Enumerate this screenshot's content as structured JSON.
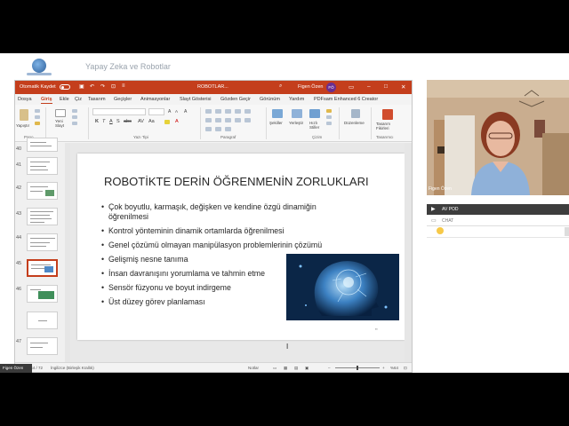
{
  "meeting": {
    "title": "Yapay Zeka ve Robotlar"
  },
  "ppt": {
    "autosave_label": "Otomatik Kaydet",
    "doc_title": "ROBOTLAR...",
    "user_name": "Figen Özen",
    "user_initials": "FÖ",
    "tabs": [
      "Dosya",
      "Giriş",
      "Ekle",
      "Çiz",
      "Tasarım",
      "Geçişler",
      "Animasyonlar",
      "Slayt Gösterisi",
      "Gözden Geçir",
      "Görünüm",
      "Yardım",
      "PDFsam Enhanced 6 Creator"
    ],
    "active_tab": "Giriş",
    "ribbon": {
      "paste": "Yapıştır",
      "new_slide": "Yeni\nSlayt",
      "shapes": "Şekiller",
      "arrange": "Yerleştir",
      "quick_styles": "Hızlı\nStiller",
      "edit": "Düzenleme",
      "designer": "Tasarım\nFikirleri",
      "groups": {
        "clipboard": "Pano",
        "font": "Yazı Tipi",
        "paragraph": "Paragraf",
        "drawing": "Çizim",
        "designer": "Tasarımcı"
      }
    },
    "thumb_numbers": [
      "40",
      "41",
      "42",
      "43",
      "44",
      "45",
      "46",
      "47"
    ],
    "slide": {
      "title": "ROBOTİKTE DERİN ÖĞRENMENİN ZORLUKLARI",
      "bullets": [
        "Çok boyutlu, karmaşık, değişken ve kendine özgü dinamiğin öğrenilmesi",
        "Kontrol yönteminin dinamik ortamlarda öğrenilmesi",
        "Genel çözümü olmayan manipülasyon problemlerinin çözümü",
        "Gelişmiş nesne tanıma",
        "İnsan davranışını yorumlama  ve tahmin etme",
        "Sensör füzyonu ve boyut indirgeme",
        "Üst düzey görev planlaması"
      ]
    },
    "status": {
      "slide_count": "Slayt 44 / 72",
      "language": "İngilizce (Birleşik Krallık)",
      "notes": "Notlar",
      "zoom": "%64"
    }
  },
  "presenter_tag": "Figen Özen",
  "video_name": "Figen Özen",
  "av_label": "AV POD",
  "chat_label": "CHAT",
  "colors": {
    "ppt_accent": "#c43e1c",
    "pod_bar": "#3d3d3d"
  }
}
